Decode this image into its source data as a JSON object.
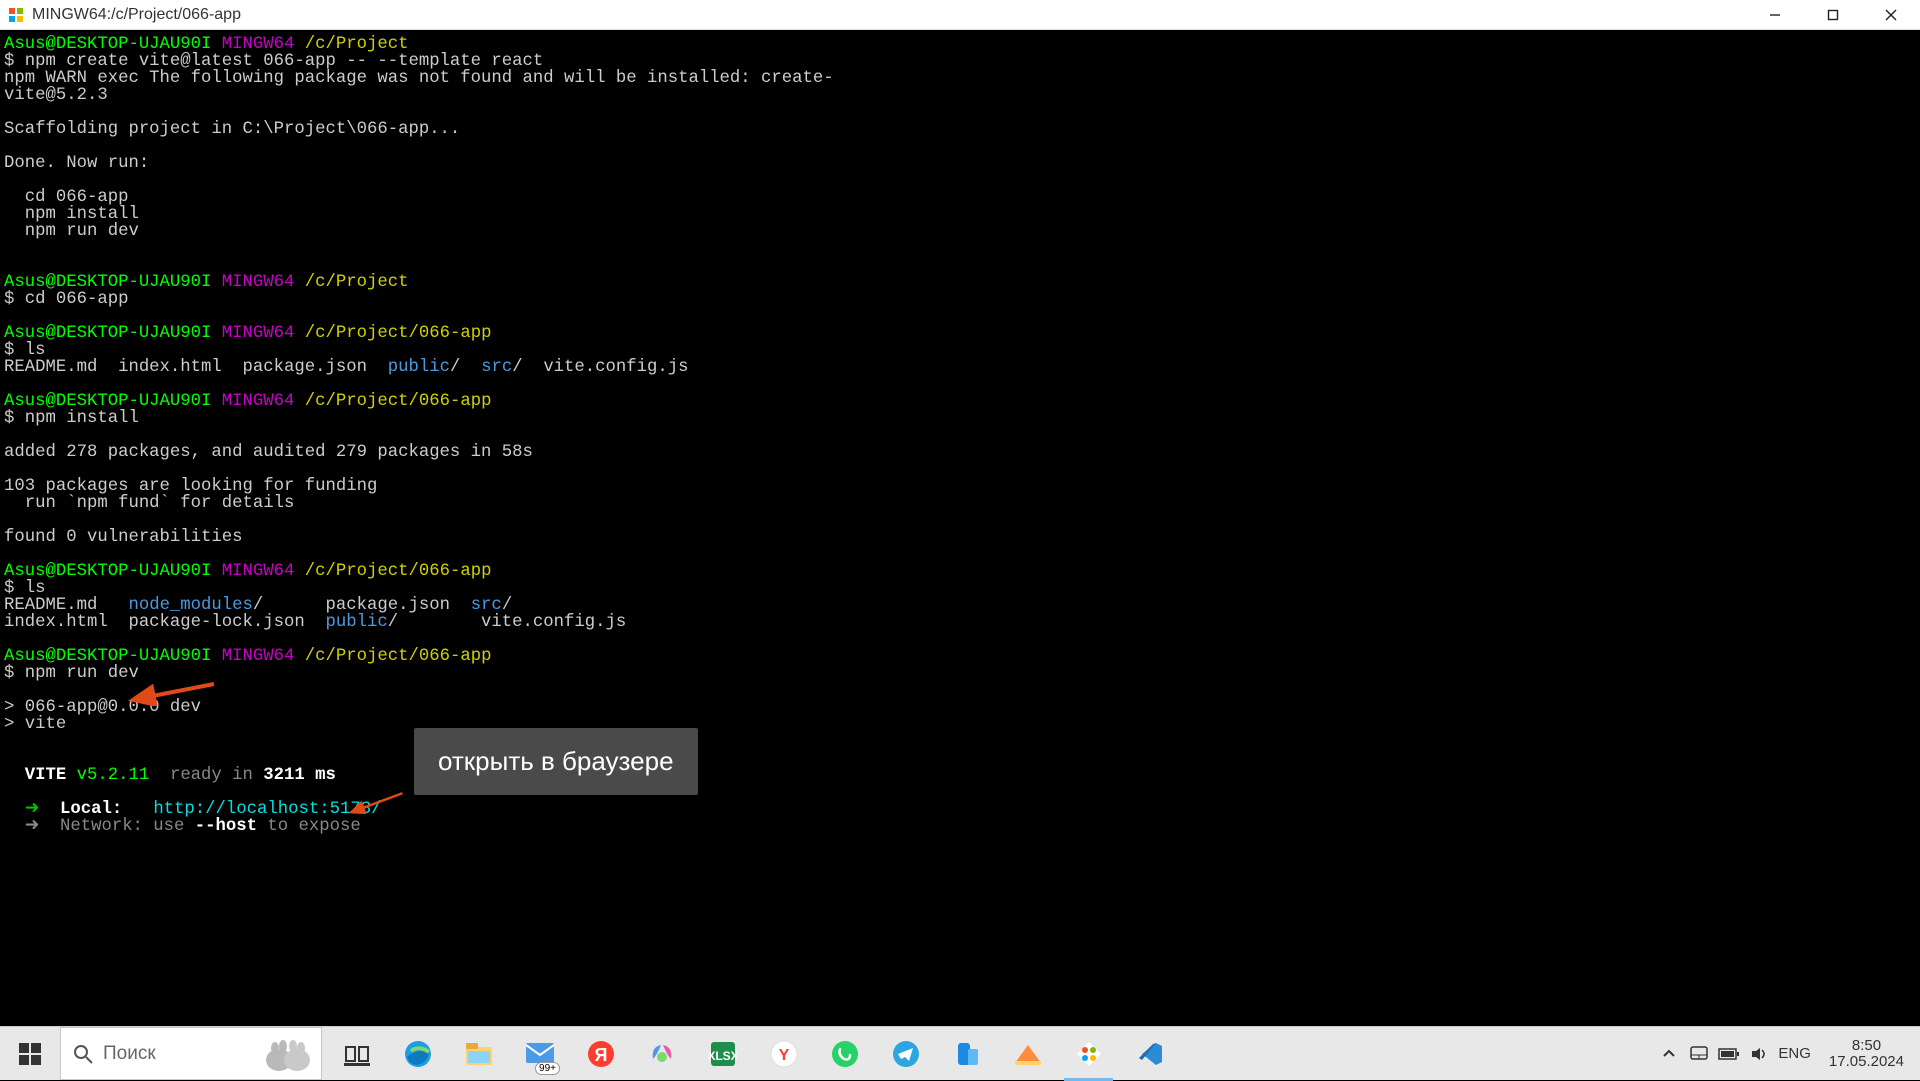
{
  "titlebar": {
    "title": "MINGW64:/c/Project/066-app"
  },
  "annotation": {
    "label": "открыть в браузере"
  },
  "taskbar": {
    "search_placeholder": "Поиск",
    "lang": "ENG",
    "time": "8:50",
    "date": "17.05.2024",
    "badge": "99+"
  },
  "term": {
    "user": "Asus@DESKTOP-UJAU90I",
    "shell": "MINGW64",
    "path_proj": "/c/Project",
    "path_app": "/c/Project/066-app",
    "cmd_create": "$ npm create vite@latest 066-app -- --template react",
    "warn1": "npm WARN exec The following package was not found and will be installed: create-",
    "warn2": "vite@5.2.3",
    "scaffold": "Scaffolding project in C:\\Project\\066-app...",
    "donerun": "Done. Now run:",
    "step_cd": "  cd 066-app",
    "step_install": "  npm install",
    "step_dev": "  npm run dev",
    "cmd_cd": "$ cd 066-app",
    "cmd_ls": "$ ls",
    "ls1_a": "README.md  index.html  package.json  ",
    "ls1_public": "public",
    "ls1_b": "/  ",
    "ls1_src": "src",
    "ls1_c": "/  vite.config.js",
    "cmd_npminstall": "$ npm install",
    "npm_added": "added 278 packages, and audited 279 packages in 58s",
    "npm_fund1": "103 packages are looking for funding",
    "npm_fund2": "  run `npm fund` for details",
    "npm_vuln": "found 0 vulnerabilities",
    "ls2_row1a": "README.md   ",
    "ls2_node": "node_modules",
    "ls2_row1b": "/      package.json  ",
    "ls2_src": "src",
    "ls2_row1c": "/",
    "ls2_row2a": "index.html  package-lock.json  ",
    "ls2_public": "public",
    "ls2_row2b": "/        vite.config.js",
    "cmd_rundev": "$ npm run dev",
    "dev_line1": "> 066-app@0.0.0 dev",
    "dev_line2": "> vite",
    "vite_name": "VITE",
    "vite_ver": "v5.2.11",
    "vite_ready": "  ready in ",
    "vite_ms": "3211 ms",
    "arrow": "  ➜  ",
    "local_label": "Local:   ",
    "local_url": "http://localhost:5173/",
    "net_label": "Network: use ",
    "net_flag": "--host",
    "net_rest": " to expose"
  }
}
